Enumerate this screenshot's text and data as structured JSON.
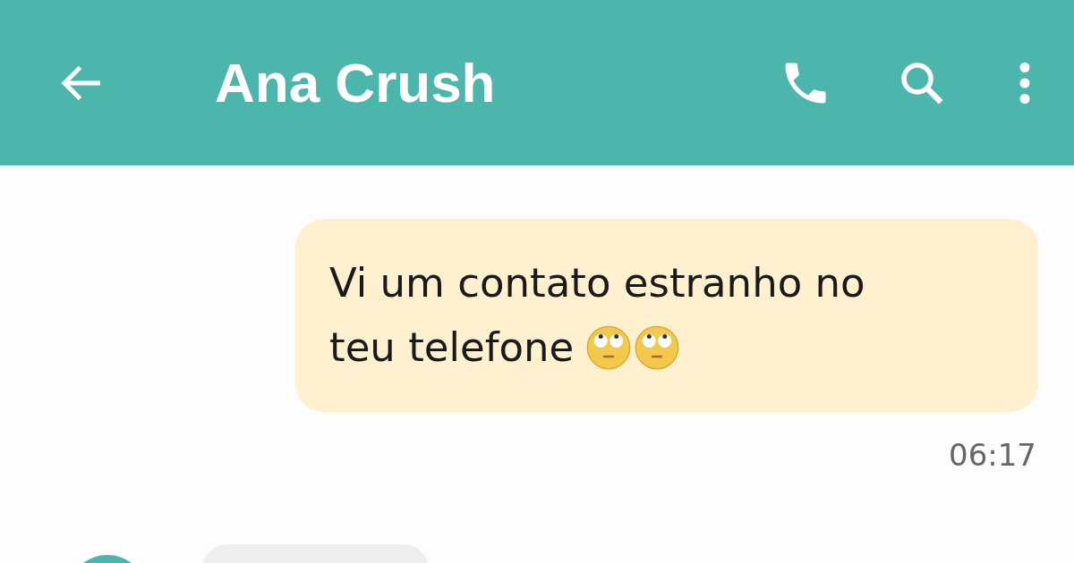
{
  "header": {
    "title": "Ana Crush"
  },
  "messages": [
    {
      "kind": "sent",
      "lines": [
        {
          "parts": [
            {
              "kind": "text",
              "text": "Vi um contato estranho no"
            }
          ]
        },
        {
          "parts": [
            {
              "kind": "text",
              "text": "teu telefone"
            },
            {
              "kind": "emoji"
            },
            {
              "kind": "emoji"
            }
          ]
        }
      ],
      "time": "06:17"
    },
    {
      "kind": "received"
    }
  ]
}
